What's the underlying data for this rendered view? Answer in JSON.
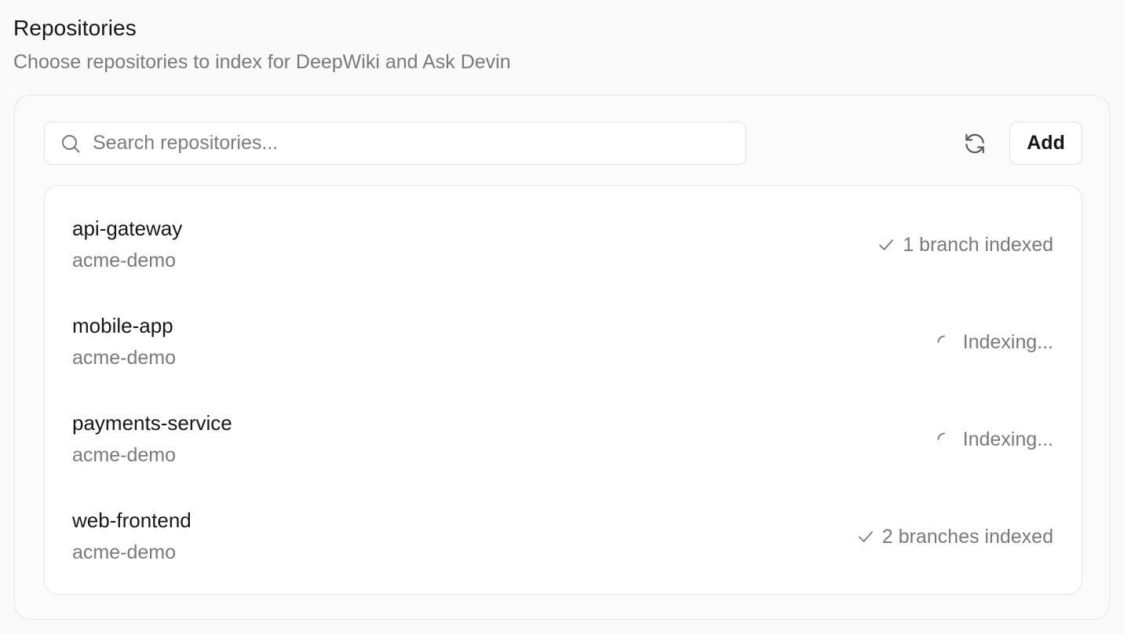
{
  "section": {
    "title": "Repositories",
    "subtitle": "Choose repositories to index for DeepWiki and Ask Devin"
  },
  "search": {
    "placeholder": "Search repositories...",
    "value": "",
    "icon": "search-icon"
  },
  "toolbar": {
    "refresh_icon": "refresh-icon",
    "add_label": "Add"
  },
  "repositories": [
    {
      "name": "api-gateway",
      "owner": "acme-demo",
      "status": "1 branch indexed",
      "status_icon": "check-icon"
    },
    {
      "name": "mobile-app",
      "owner": "acme-demo",
      "status": "Indexing...",
      "status_icon": "spinner-icon"
    },
    {
      "name": "payments-service",
      "owner": "acme-demo",
      "status": "Indexing...",
      "status_icon": "spinner-icon"
    },
    {
      "name": "web-frontend",
      "owner": "acme-demo",
      "status": "2 branches indexed",
      "status_icon": "check-icon"
    }
  ],
  "colors": {
    "muted_text": "#7a7a7a",
    "border": "#e6e6e6",
    "background": "#fafafa"
  }
}
